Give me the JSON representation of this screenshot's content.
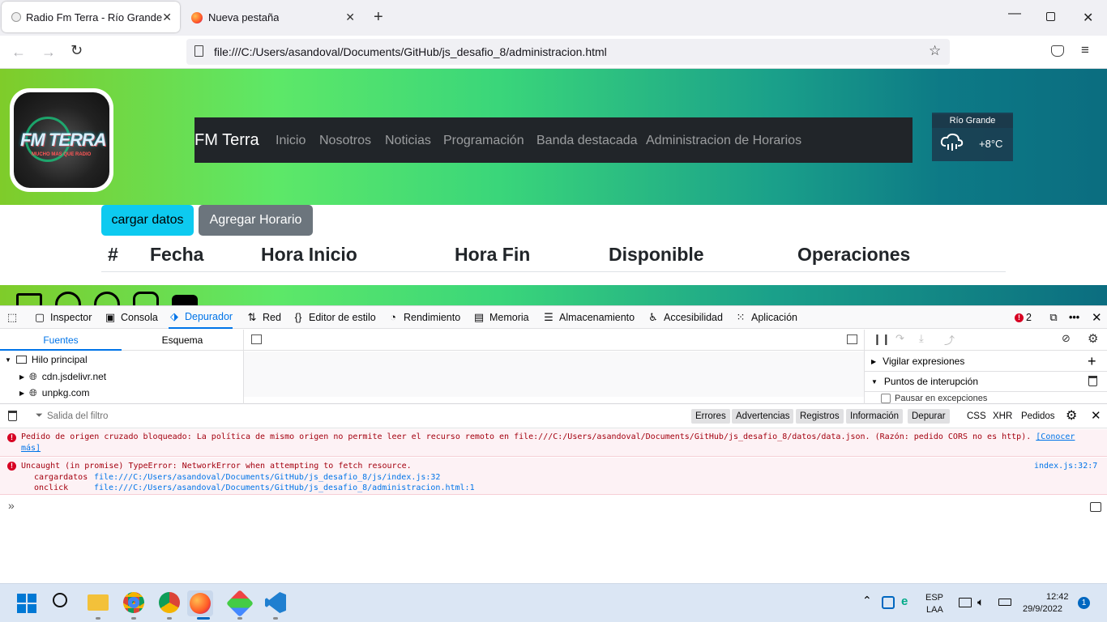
{
  "browser": {
    "tabs": [
      {
        "title": "Radio Fm Terra - Río Grande - Ti",
        "active": true
      },
      {
        "title": "Nueva pestaña",
        "active": false
      }
    ],
    "new_tab_symbol": "+",
    "url": "file:///C:/Users/asandoval/Documents/GitHub/js_desafio_8/administracion.html"
  },
  "page": {
    "logo_text": "FM TERRA",
    "logo_slogan": "MUCHO MAS QUE RADIO",
    "brand": "FM Terra",
    "nav": [
      "Inicio",
      "Nosotros",
      "Noticias",
      "Programación",
      "Banda destacada",
      "Administracion de Horarios"
    ],
    "weather": {
      "city": "Río Grande",
      "temp": "+8°C",
      "icon": "cloud-rain-icon"
    },
    "buttons": {
      "load": "cargar datos",
      "add": "Agregar Horario"
    },
    "table_headers": [
      "#",
      "Fecha",
      "Hora Inicio",
      "Hora Fin",
      "Disponible",
      "Operaciones"
    ],
    "social_icons": [
      "mail-icon",
      "whatsapp-icon",
      "facebook-icon",
      "instagram-icon",
      "youtube-icon"
    ],
    "colors": {
      "nav_bg": "#212529",
      "info_btn": "#0dcaf0",
      "secondary_btn": "#6c757d"
    }
  },
  "devtools": {
    "tabs": [
      "Inspector",
      "Consola",
      "Depurador",
      "Red",
      "Editor de estilo",
      "Rendimiento",
      "Memoria",
      "Almacenamiento",
      "Accesibilidad",
      "Aplicación"
    ],
    "active_tab": "Depurador",
    "error_count": "2",
    "source_tabs": [
      "Fuentes",
      "Esquema"
    ],
    "tree": {
      "root": "Hilo principal",
      "items": [
        "cdn.jsdelivr.net",
        "unpkg.com"
      ]
    },
    "side_sections": [
      "Vigilar expresiones",
      "Puntos de interupción"
    ],
    "pause_on_exceptions": "Pausar en excepciones",
    "console": {
      "filter_placeholder": "Salida del filtro",
      "filters": [
        "Errores",
        "Advertencias",
        "Registros",
        "Información",
        "Depurar"
      ],
      "extra_filters": [
        "CSS",
        "XHR",
        "Pedidos"
      ],
      "messages": [
        {
          "text": "Pedido de origen cruzado bloqueado: La política de mismo origen no permite leer el recurso remoto en file:///C:/Users/asandoval/Documents/GitHub/js_desafio_8/datos/data.json. (Razón: pedido CORS no es http).",
          "link": "[Conocer",
          "link2": "más]"
        },
        {
          "text": "Uncaught (in promise) TypeError: NetworkError when attempting to fetch resource.",
          "location": "index.js:32:7",
          "trace": [
            {
              "fn": "cargardatos",
              "loc": "file:///C:/Users/asandoval/Documents/GitHub/js_desafio_8/js/index.js:32"
            },
            {
              "fn": "onclick",
              "loc": "file:///C:/Users/asandoval/Documents/GitHub/js_desafio_8/administracion.html:1"
            }
          ]
        }
      ]
    }
  },
  "taskbar": {
    "lang": "ESP",
    "layout": "LAA",
    "time": "12:42",
    "date": "29/9/2022",
    "notifications": "1"
  }
}
